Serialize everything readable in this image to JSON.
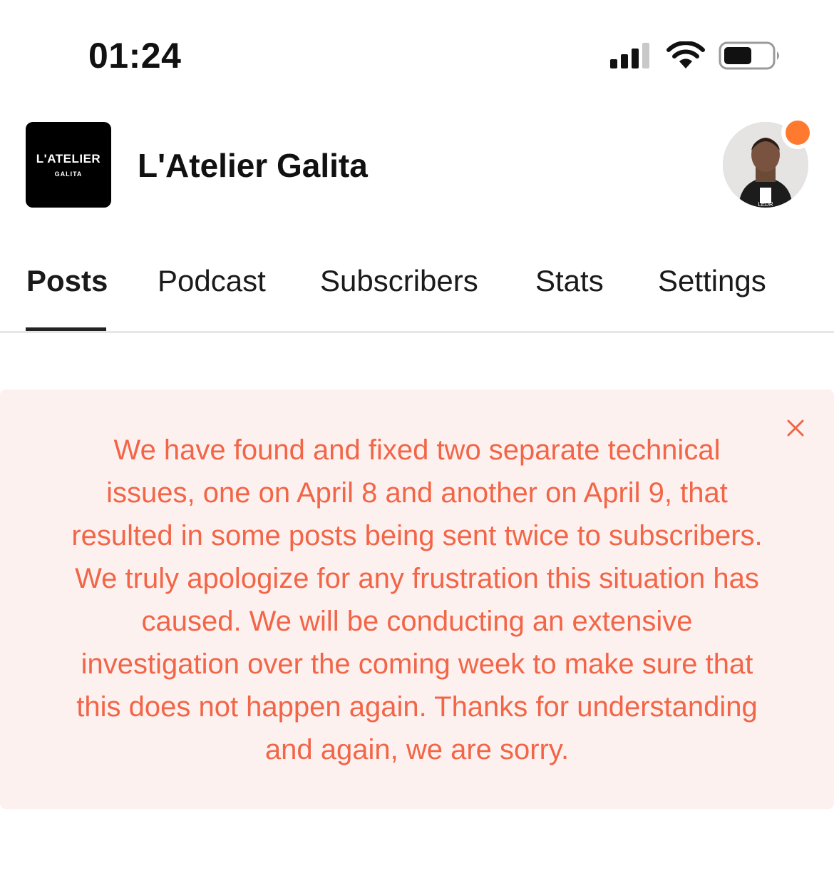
{
  "status_bar": {
    "time": "01:24",
    "icons": [
      "cellular-signal-icon",
      "wifi-icon",
      "battery-icon"
    ]
  },
  "header": {
    "logo": {
      "line1": "L'ATELIER",
      "line2": "GALITA"
    },
    "title": "L'Atelier Galita",
    "avatar_badge_color": "#ff7a2e"
  },
  "tabs": [
    {
      "label": "Posts",
      "active": true
    },
    {
      "label": "Podcast",
      "active": false
    },
    {
      "label": "Subscribers",
      "active": false
    },
    {
      "label": "Stats",
      "active": false
    },
    {
      "label": "Settings",
      "active": false
    }
  ],
  "banner": {
    "message": "We have found and fixed two separate technical issues, one on April 8 and another on April 9, that resulted in some posts being sent twice to subscribers. We truly apologize for any frustration this situation has caused. We will be conducting an extensive investigation over the coming week to make sure that this does not happen again. Thanks for understanding and again, we are sorry.",
    "text_color": "#f26547",
    "background_color": "#fdf1ef",
    "close_icon": "close-icon"
  }
}
